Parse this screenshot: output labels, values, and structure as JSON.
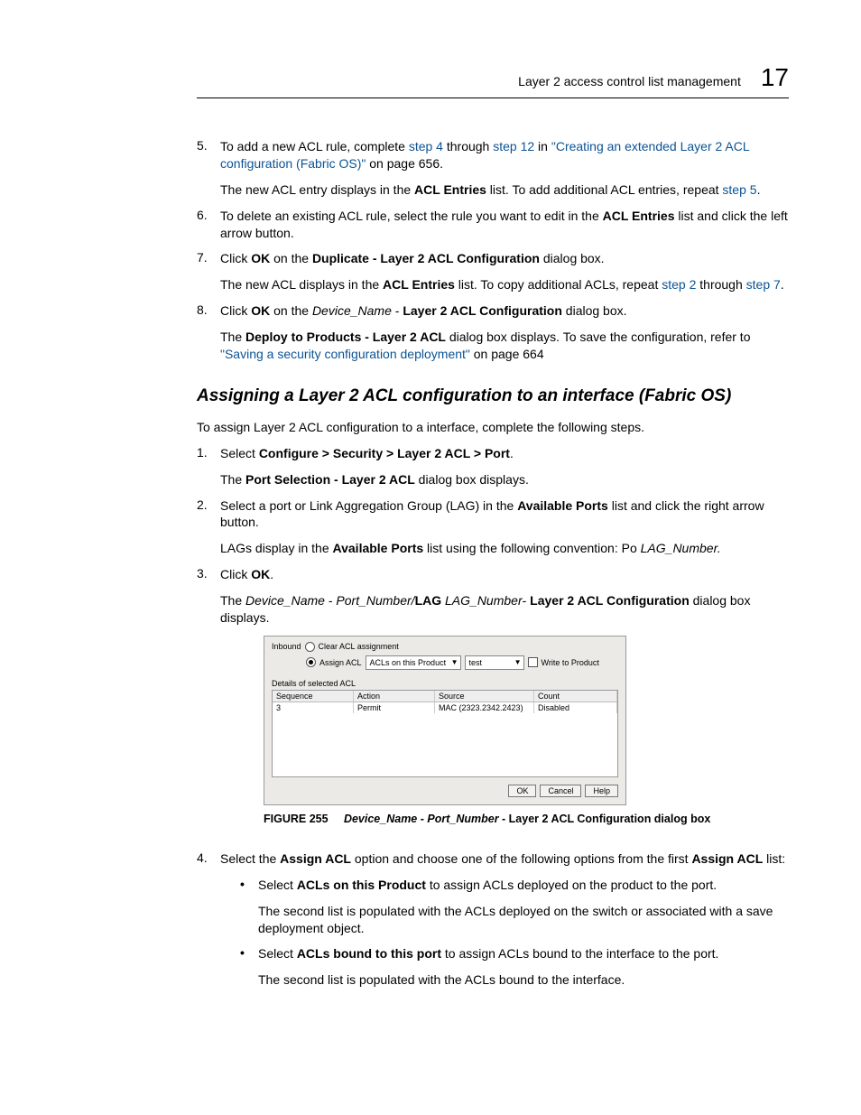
{
  "header": {
    "title": "Layer 2 access control list management",
    "chapter": "17"
  },
  "steps_a": {
    "s5": {
      "num": "5.",
      "pre": "To add a new ACL rule, complete ",
      "l1": "step 4",
      "mid1": " through ",
      "l2": "step 12",
      "mid2": " in ",
      "l3": "\"Creating an extended Layer 2 ACL configuration (Fabric OS)\"",
      "post": " on page 656.",
      "p2a": "The new ACL entry displays in the ",
      "p2b": "ACL Entries",
      "p2c": " list. To add additional ACL entries, repeat ",
      "p2d": "step 5",
      "p2e": "."
    },
    "s6": {
      "num": "6.",
      "t1": "To delete an existing ACL rule, select the rule you want to edit in the ",
      "b1": "ACL Entries",
      "t2": " list and click the left arrow button."
    },
    "s7": {
      "num": "7.",
      "t1": "Click ",
      "b1": "OK",
      "t2": " on the ",
      "b2": "Duplicate - Layer 2 ACL Configuration",
      "t3": " dialog box.",
      "p2a": "The new ACL displays in the ",
      "p2b": "ACL Entries",
      "p2c": " list. To copy additional ACLs, repeat ",
      "p2d": "step 2",
      "p2e": " through ",
      "p2f": "step 7",
      "p2g": "."
    },
    "s8": {
      "num": "8.",
      "t1": "Click ",
      "b1": "OK",
      "t2": " on the ",
      "i1": "Device_Name",
      "t3": " - ",
      "b2": "Layer 2 ACL Configuration",
      "t4": " dialog box.",
      "p2a": "The ",
      "p2b": "Deploy to Products - Layer 2 ACL",
      "p2c": " dialog box displays. To save the configuration, refer to ",
      "p2d": "\"Saving a security configuration deployment\"",
      "p2e": " on page 664"
    }
  },
  "h2": "Assigning a Layer 2 ACL configuration to an interface (Fabric OS)",
  "intro": "To assign Layer 2 ACL configuration to a interface, complete the following steps.",
  "steps_b": {
    "s1": {
      "num": "1.",
      "t1": "Select ",
      "b1": "Configure > Security > Layer 2 ACL > Port",
      "t2": ".",
      "p2a": "The ",
      "p2b": "Port Selection - Layer 2 ACL",
      "p2c": " dialog box displays."
    },
    "s2": {
      "num": "2.",
      "t1": "Select a port or Link Aggregation Group (LAG) in the ",
      "b1": "Available Ports",
      "t2": " list and click the right arrow button.",
      "p2a": "LAGs display in the ",
      "p2b": "Available Ports",
      "p2c": " list using the following convention: Po ",
      "p2d": "LAG_Number.",
      "p2e": ""
    },
    "s3": {
      "num": "3.",
      "t1": "Click ",
      "b1": "OK",
      "t2": ".",
      "p2a": "The ",
      "p2b": "Device_Name",
      "p2c": " - ",
      "p2d": "Port_Number/",
      "p2e": "LAG",
      "p2f": " LAG_Number",
      "p2g": "- ",
      "p2h": "Layer 2 ACL Configuration",
      "p2i": " dialog box displays."
    },
    "s4": {
      "num": "4.",
      "t1": "Select the ",
      "b1": "Assign ACL",
      "t2": " option and choose one of the following options from the first ",
      "b2": "Assign ACL",
      "t3": " list:"
    }
  },
  "bullets": {
    "b1": {
      "t1": "Select ",
      "bold": "ACLs on this Product",
      "t2": " to assign ACLs deployed on the product to the port.",
      "p2": "The second list is populated with the ACLs deployed on the switch or associated with a save deployment object."
    },
    "b2": {
      "t1": "Select ",
      "bold": "ACLs bound to this port",
      "t2": " to assign ACLs bound to the interface to the port.",
      "p2": "The second list is populated with the ACLs bound to the interface."
    }
  },
  "dialog": {
    "inbound": "Inbound",
    "clear": "Clear ACL assignment",
    "assign": "Assign ACL",
    "combo1": "ACLs on this Product",
    "combo2": "test",
    "write": "Write to Product",
    "details": "Details of selected ACL",
    "th": {
      "seq": "Sequence",
      "act": "Action",
      "src": "Source",
      "cnt": "Count"
    },
    "row": {
      "seq": "3",
      "act": "Permit",
      "src": "MAC (2323.2342.2423)",
      "cnt": "Disabled"
    },
    "ok": "OK",
    "cancel": "Cancel",
    "help": "Help"
  },
  "figcap": {
    "lead": "FIGURE 255",
    "i1": "Device_Name",
    "sep": " - ",
    "i2": "Port_Number",
    "tail": " - Layer 2 ACL Configuration dialog box"
  }
}
